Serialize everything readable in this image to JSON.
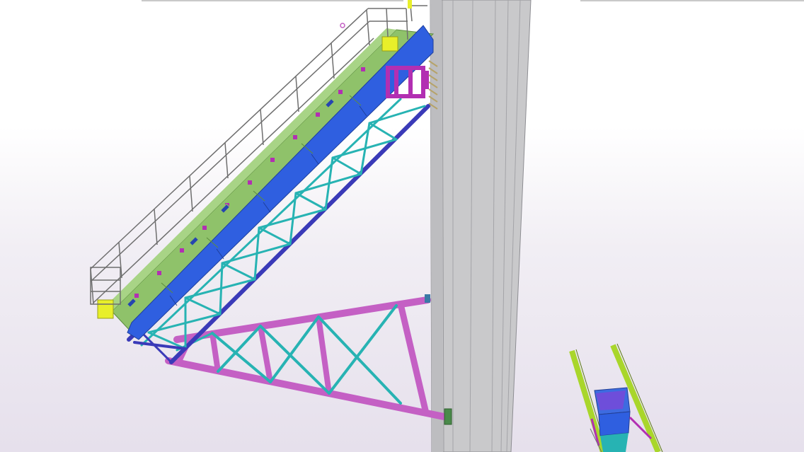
{
  "viewer": {
    "background_top": "#ffffff",
    "background_bottom": "#e6e0ec"
  },
  "model": {
    "objects": [
      "concrete-column",
      "conveyor-gallery",
      "walkway-handrail",
      "gallery-truss",
      "support-bracket-truss",
      "transfer-chute"
    ]
  },
  "colors": {
    "column": "#c9c9cb",
    "column_edge": "#8d8d92",
    "walkway": "#8fc26a",
    "belt_cover": "#2f5fe0",
    "truss_chord": "#3a3ab8",
    "truss_bracing": "#27b3b3",
    "bracket": "#c460c4",
    "accent_magenta": "#b22fb2",
    "handrail": "#6e6e6e",
    "yellow_plate": "#e8ef2a",
    "chute_green": "#a9d62b",
    "chute_blue": "#3d6be0"
  }
}
